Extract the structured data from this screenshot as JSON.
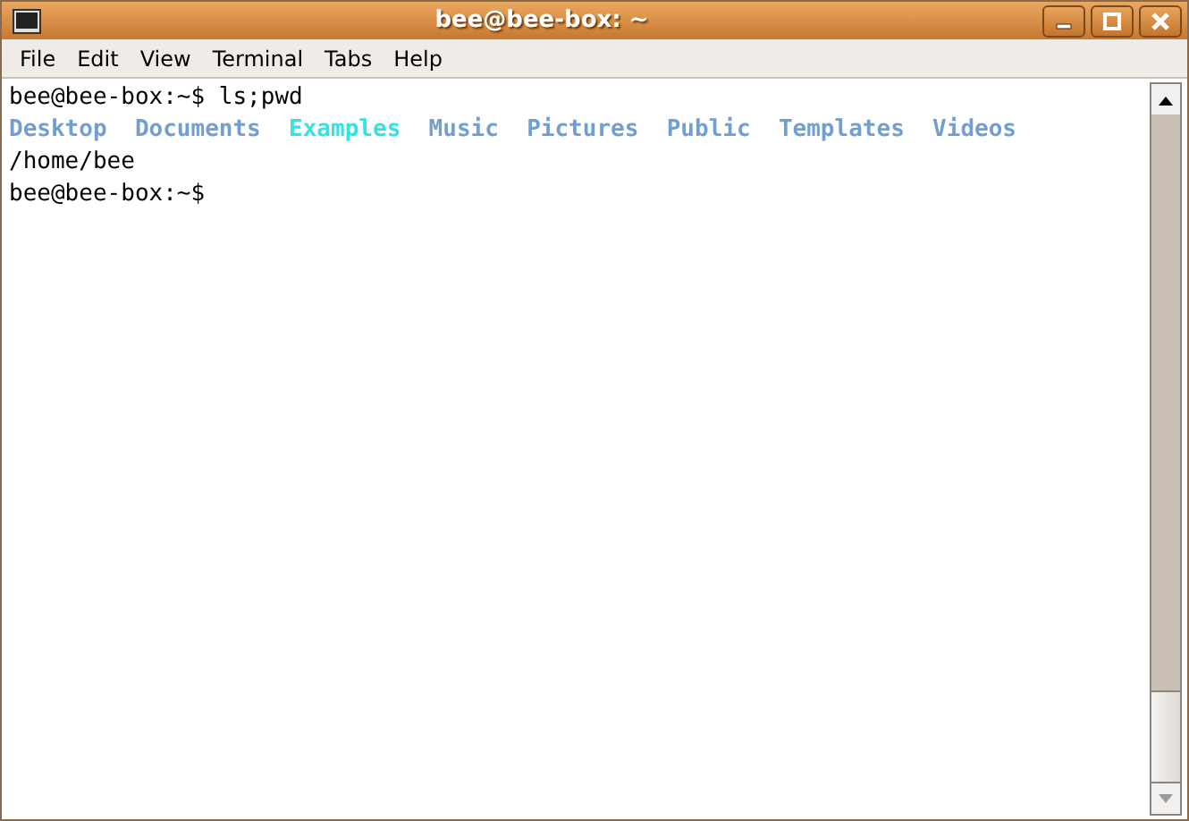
{
  "window": {
    "title": "bee@bee-box: ~"
  },
  "menu": [
    "File",
    "Edit",
    "View",
    "Terminal",
    "Tabs",
    "Help"
  ],
  "terminal": {
    "lines": [
      {
        "kind": "text",
        "text": "bee@bee-box:~$ ls;pwd"
      },
      {
        "kind": "listing",
        "entries": [
          {
            "name": "Desktop",
            "color": "#729fcf"
          },
          {
            "name": "Documents",
            "color": "#729fcf"
          },
          {
            "name": "Examples",
            "color": "#34e2e2"
          },
          {
            "name": "Music",
            "color": "#729fcf"
          },
          {
            "name": "Pictures",
            "color": "#729fcf"
          },
          {
            "name": "Public",
            "color": "#729fcf"
          },
          {
            "name": "Templates",
            "color": "#729fcf"
          },
          {
            "name": "Videos",
            "color": "#729fcf"
          }
        ]
      },
      {
        "kind": "text",
        "text": "/home/bee"
      },
      {
        "kind": "text",
        "text": "bee@bee-box:~$"
      }
    ]
  }
}
